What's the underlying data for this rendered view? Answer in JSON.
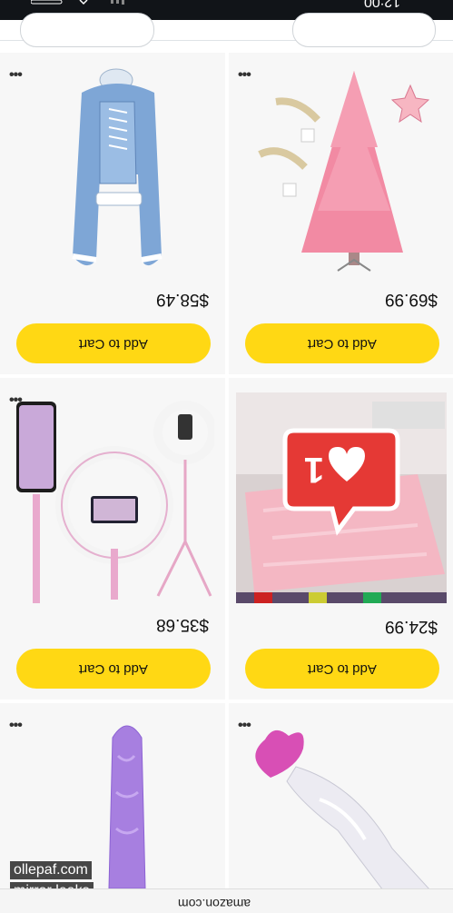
{
  "colors": {
    "cart_button": "#FFD814",
    "status_bar": "#111418",
    "notification": "#e53935"
  },
  "status_bar": {
    "time": "12:00"
  },
  "products": [
    {
      "id": "pink-christmas-tree",
      "price": "$69.99",
      "cta": "Add to Cart",
      "menu": "•••",
      "image": "pink-christmas-tree-image"
    },
    {
      "id": "blue-costume",
      "price": "$58.49",
      "cta": "Add to Cart",
      "menu": "•••",
      "image": "blue-costume-image"
    },
    {
      "id": "pink-rug",
      "price": "$24.99",
      "cta": "Add to Cart",
      "menu": "•••",
      "image": "pink-rug-image"
    },
    {
      "id": "pink-ring-light",
      "price": "$35.68",
      "cta": "Add to Cart",
      "menu": "•••",
      "image": "ring-light-image"
    },
    {
      "id": "glass-heart-item",
      "menu": "•••",
      "image": "glass-heart-image"
    },
    {
      "id": "purple-item",
      "menu": "•••",
      "image": "purple-item-image"
    }
  ],
  "notification": {
    "count": "1",
    "icon": "heart-icon"
  },
  "browser": {
    "url": "amazon.com"
  },
  "watermark": {
    "line1": "ollepaf.com",
    "line2": "mirror leaks"
  }
}
